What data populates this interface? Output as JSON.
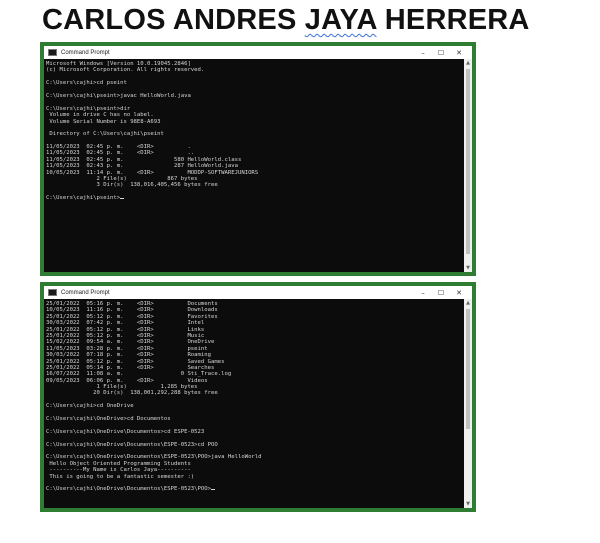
{
  "title_part1": "CARLOS ANDRES ",
  "title_part2": "JAYA",
  "title_part3": " HERRERA",
  "window_title": "Command Prompt",
  "controls": {
    "minimize": "–",
    "maximize": "☐",
    "close": "✕"
  },
  "terminal1": [
    "Microsoft Windows [Version 10.0.19045.2846]",
    "(c) Microsoft Corporation. All rights reserved.",
    "",
    "C:\\Users\\cajhi>cd pseint",
    "",
    "C:\\Users\\cajhi\\pseint>javac HelloWorld.java",
    "",
    "C:\\Users\\cajhi\\pseint>dir",
    " Volume in drive C has no label.",
    " Volume Serial Number is 98E8-A693",
    "",
    " Directory of C:\\Users\\cajhi\\pseint",
    "",
    "11/05/2023  02:45 p. m.    <DIR>          .",
    "11/05/2023  02:45 p. m.    <DIR>          ..",
    "11/05/2023  02:45 p. m.               580 HelloWorld.class",
    "11/05/2023  02:43 p. m.               287 HelloWorld.java",
    "10/05/2023  11:14 p. m.    <DIR>          MODDP-SOFTWAREJUNIORS",
    "               2 File(s)            867 bytes",
    "               3 Dir(s)  138,016,405,456 bytes free",
    "",
    "C:\\Users\\cajhi\\pseint>"
  ],
  "terminal2": [
    "25/01/2022  05:16 p. m.    <DIR>          Documents",
    "10/05/2023  11:16 p. m.    <DIR>          Downloads",
    "25/01/2022  05:12 p. m.    <DIR>          Favorites",
    "30/03/2022  07:42 p. m.    <DIR>          Intel",
    "25/01/2022  05:12 p. m.    <DIR>          Links",
    "25/01/2022  05:12 p. m.    <DIR>          Music",
    "15/02/2022  09:54 a. m.    <DIR>          OneDrive",
    "11/05/2023  03:28 p. m.    <DIR>          pseint",
    "30/03/2022  07:18 p. m.    <DIR>          Roaming",
    "25/01/2022  05:12 p. m.    <DIR>          Saved Games",
    "25/01/2022  05:14 p. m.    <DIR>          Searches",
    "16/07/2022  11:08 a. m.                 0 Sti_Trace.log",
    "09/05/2023  06:06 p. m.    <DIR>          Videos",
    "               1 File(s)          1,285 bytes",
    "              20 Dir(s)  138,001,292,288 bytes free",
    "",
    "C:\\Users\\cajhi>cd OneDrive",
    "",
    "C:\\Users\\cajhi\\OneDrive>cd Documentos",
    "",
    "C:\\Users\\cajhi\\OneDrive\\Documentos>cd ESPE-0523",
    "",
    "C:\\Users\\cajhi\\OneDrive\\Documentos\\ESPE-0523>cd POO",
    "",
    "C:\\Users\\cajhi\\OneDrive\\Documentos\\ESPE-0523\\POO>java HelloWorld",
    " Hello Object Oriented Programming Students",
    " ----------My Name is Carlos Jaya----------",
    " This is going to be a fantastic semester :)",
    "",
    "C:\\Users\\cajhi\\OneDrive\\Documentos\\ESPE-0523\\POO>"
  ]
}
